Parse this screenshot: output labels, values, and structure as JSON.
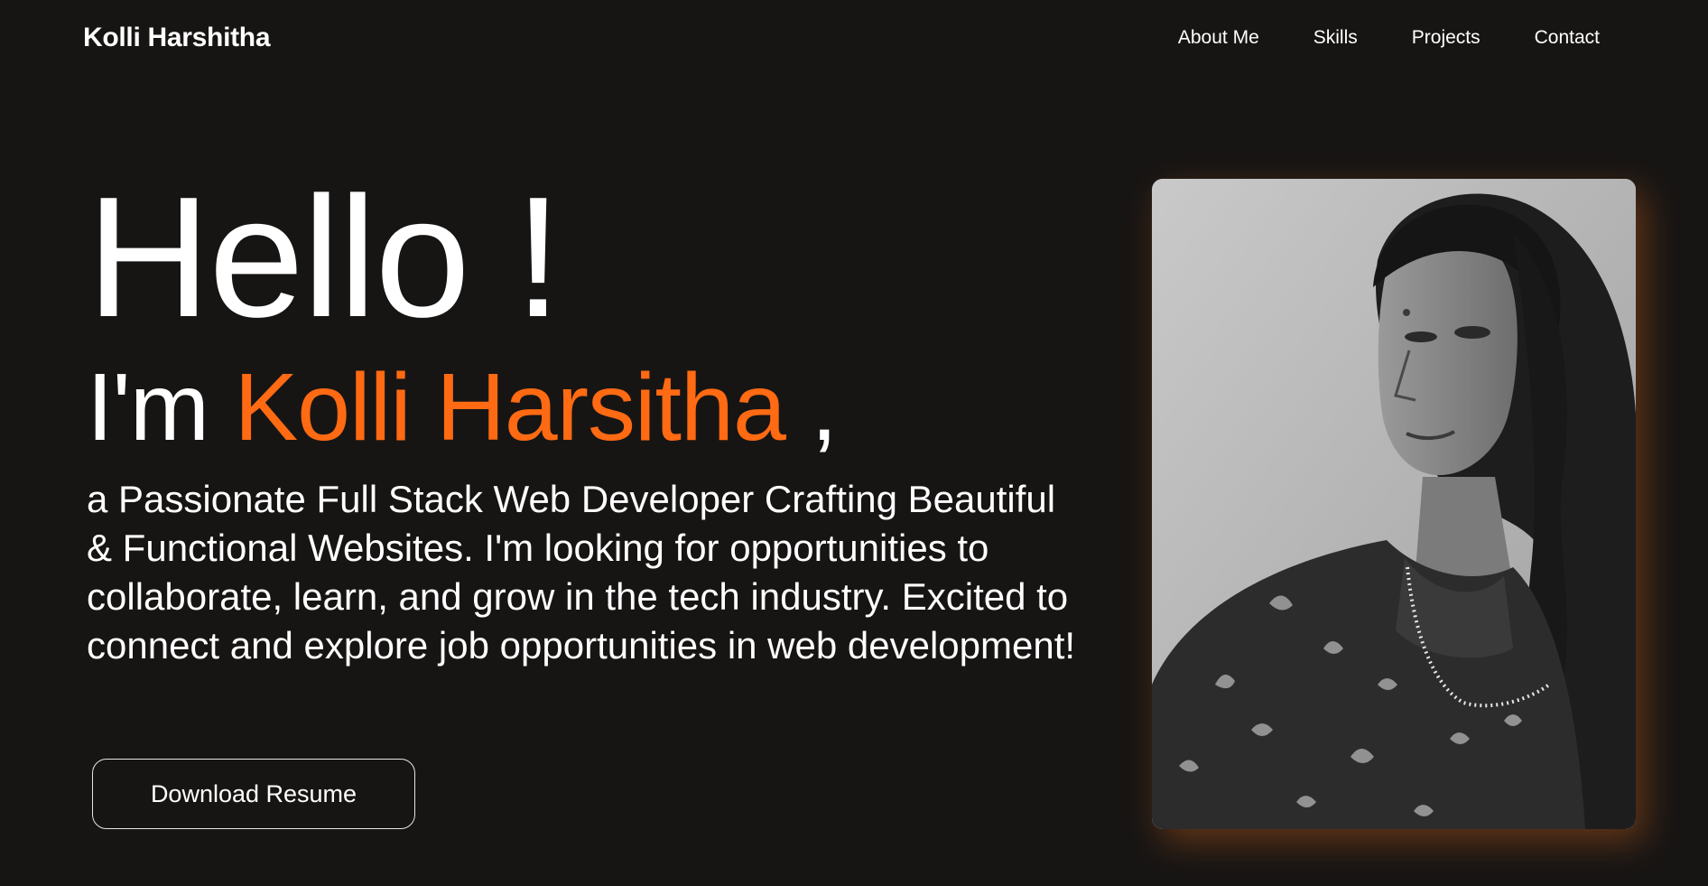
{
  "header": {
    "brand": "Kolli Harshitha",
    "nav": [
      {
        "label": "About Me"
      },
      {
        "label": "Skills"
      },
      {
        "label": "Projects"
      },
      {
        "label": "Contact"
      }
    ]
  },
  "hero": {
    "greeting": "Hello !",
    "intro_prefix": "I'm ",
    "intro_name": "Kolli Harsitha",
    "intro_suffix": " ,",
    "tagline": "a Passionate Full Stack Web Developer Crafting Beautiful & Functional Websites. I'm looking for opportunities to collaborate, learn, and grow in the tech industry. Excited to connect and explore job opportunities in web development!",
    "resume_button": "Download Resume",
    "photo": "portrait-photo"
  },
  "colors": {
    "background": "#171514",
    "accent": "#ff6a13",
    "text": "#ffffff"
  }
}
